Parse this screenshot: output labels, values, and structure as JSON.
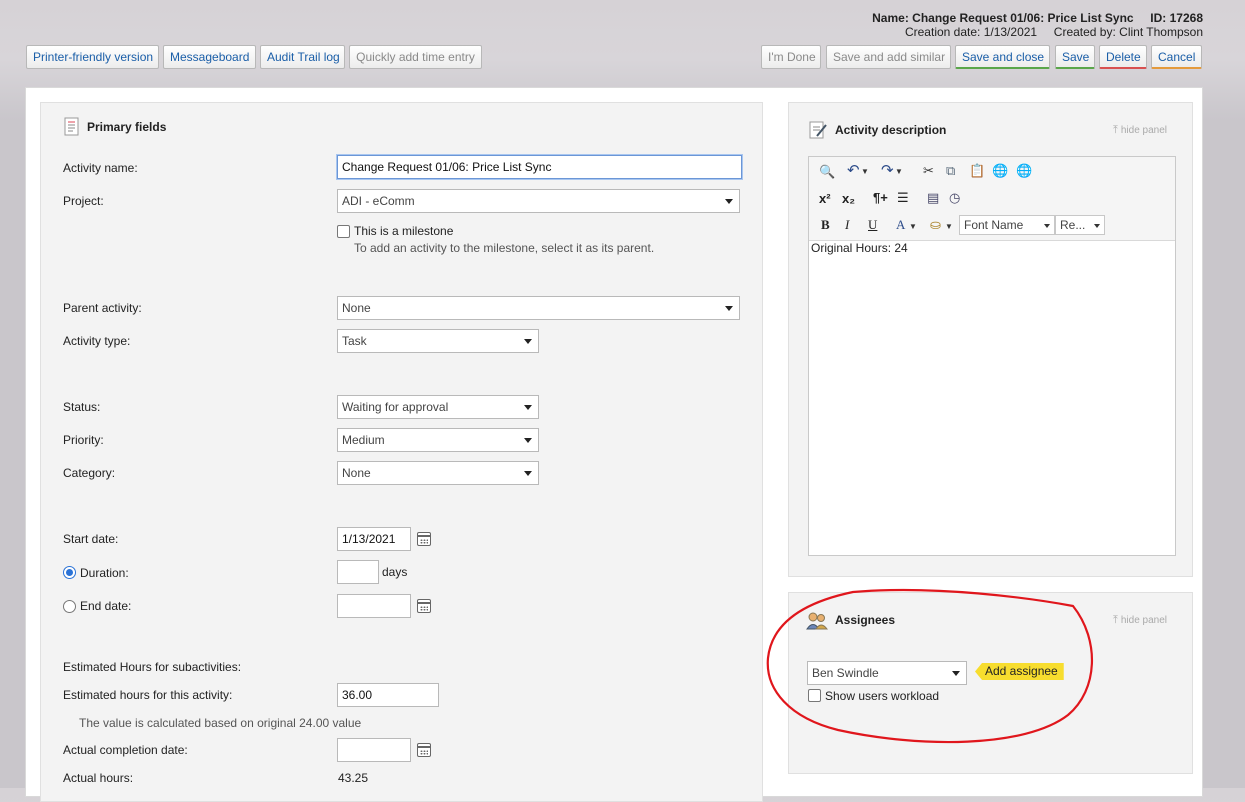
{
  "header": {
    "name_label": "Name:",
    "name_value": "Change Request 01/06: Price List Sync",
    "id_label": "ID:",
    "id_value": "17268",
    "creation_label": "Creation date:",
    "creation_value": "1/13/2021",
    "created_by_label": "Created by:",
    "created_by_value": "Clint Thompson"
  },
  "toolbar": {
    "printer_friendly": "Printer-friendly version",
    "messageboard": "Messageboard",
    "audit_trail": "Audit Trail log",
    "quick_time": "Quickly add time entry",
    "im_done": "I'm Done",
    "save_add_similar": "Save and add similar",
    "save_close": "Save and close",
    "save": "Save",
    "delete": "Delete",
    "cancel": "Cancel"
  },
  "primary": {
    "title": "Primary fields",
    "activity_name_label": "Activity name:",
    "activity_name_value": "Change Request 01/06: Price List Sync",
    "project_label": "Project:",
    "project_value": "ADI - eComm",
    "milestone_label": "This is a milestone",
    "milestone_note": "To add an activity to the milestone, select it as its parent.",
    "parent_label": "Parent activity:",
    "parent_value": "None",
    "type_label": "Activity type:",
    "type_value": "Task",
    "status_label": "Status:",
    "status_value": "Waiting for approval",
    "priority_label": "Priority:",
    "priority_value": "Medium",
    "category_label": "Category:",
    "category_value": "None",
    "start_label": "Start date:",
    "start_value": "1/13/2021",
    "duration_label": "Duration:",
    "duration_value": "",
    "days_label": "days",
    "end_label": "End date:",
    "end_value": "",
    "est_sub_label": "Estimated Hours for subactivities:",
    "est_this_label": "Estimated hours for this activity:",
    "est_this_value": "36.00",
    "est_note": "The value is calculated based on original 24.00 value",
    "actual_completion_label": "Actual completion date:",
    "actual_completion_value": "",
    "actual_hours_label": "Actual hours:",
    "actual_hours_value": "43.25"
  },
  "description": {
    "title": "Activity description",
    "hide": "hide panel",
    "font_name": "Font Name",
    "font_size": "Re...",
    "content": "Original Hours: 24"
  },
  "assignees": {
    "title": "Assignees",
    "hide": "hide panel",
    "selected": "Ben Swindle",
    "add_label": "Add assignee",
    "workload_label": "Show users workload"
  },
  "icons": [
    "form-icon",
    "edit-note-icon",
    "people-icon",
    "calendar-icon",
    "find-icon",
    "undo-icon",
    "redo-icon",
    "cut-icon",
    "copy-icon",
    "paste-icon",
    "link-icon",
    "unlink-icon",
    "superscript-icon",
    "subscript-icon",
    "paragraph-icon",
    "align-icon",
    "html-icon",
    "clock-icon",
    "bold-icon",
    "italic-icon",
    "underline-icon",
    "font-color-icon",
    "highlight-icon"
  ],
  "colors": {
    "accent_blue": "#1a5ea8",
    "annotation_red": "#e0161c",
    "add_assignee_yellow": "#f7dd2e"
  }
}
